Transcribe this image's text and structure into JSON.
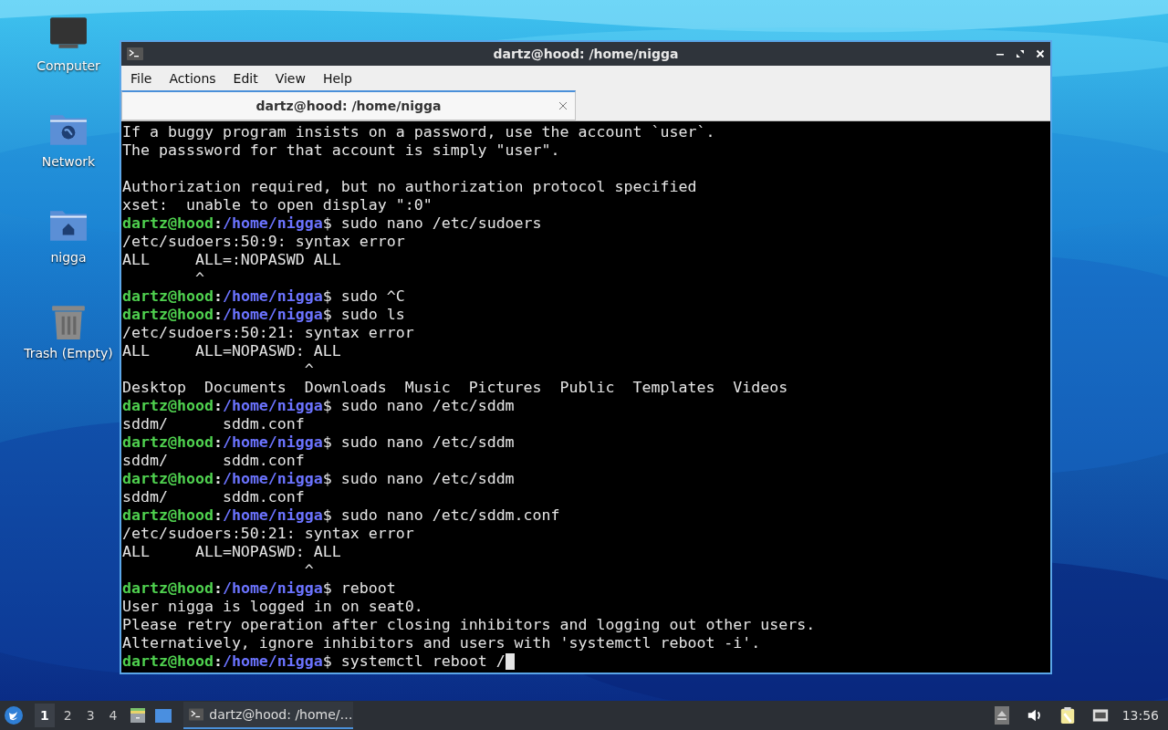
{
  "desktop_icons": [
    {
      "kind": "computer",
      "label": "Computer"
    },
    {
      "kind": "network",
      "label": "Network"
    },
    {
      "kind": "home",
      "label": "nigga"
    },
    {
      "kind": "trash",
      "label": "Trash (Empty)"
    }
  ],
  "window": {
    "title": "dartz@hood: /home/nigga",
    "menu": [
      "File",
      "Actions",
      "Edit",
      "View",
      "Help"
    ],
    "tabs": [
      {
        "label": "dartz@hood: /home/nigga",
        "selected": true
      }
    ],
    "terminal": [
      {
        "kind": "text",
        "text": "If a buggy program insists on a password, use the account `user`."
      },
      {
        "kind": "text",
        "text": "The passsword for that account is simply \"user\"."
      },
      {
        "kind": "blank"
      },
      {
        "kind": "text",
        "text": "Authorization required, but no authorization protocol specified"
      },
      {
        "kind": "text",
        "text": "xset:  unable to open display \":0\""
      },
      {
        "kind": "prompt",
        "user": "dartz@hood",
        "separator": ":",
        "path": "/home/nigga",
        "command": "$ sudo nano /etc/sudoers"
      },
      {
        "kind": "text",
        "text": "/etc/sudoers:50:9: syntax error"
      },
      {
        "kind": "text",
        "text": "ALL     ALL=:NOPASWD ALL"
      },
      {
        "kind": "text",
        "text": "        ^"
      },
      {
        "kind": "prompt",
        "user": "dartz@hood",
        "separator": ":",
        "path": "/home/nigga",
        "command": "$ sudo ^C"
      },
      {
        "kind": "prompt",
        "user": "dartz@hood",
        "separator": ":",
        "path": "/home/nigga",
        "command": "$ sudo ls"
      },
      {
        "kind": "text",
        "text": "/etc/sudoers:50:21: syntax error"
      },
      {
        "kind": "text",
        "text": "ALL     ALL=NOPASWD: ALL"
      },
      {
        "kind": "text",
        "text": "                    ^"
      },
      {
        "kind": "text",
        "text": "Desktop  Documents  Downloads  Music  Pictures  Public  Templates  Videos"
      },
      {
        "kind": "prompt",
        "user": "dartz@hood",
        "separator": ":",
        "path": "/home/nigga",
        "command": "$ sudo nano /etc/sddm"
      },
      {
        "kind": "text",
        "text": "sddm/      sddm.conf"
      },
      {
        "kind": "prompt",
        "user": "dartz@hood",
        "separator": ":",
        "path": "/home/nigga",
        "command": "$ sudo nano /etc/sddm"
      },
      {
        "kind": "text",
        "text": "sddm/      sddm.conf"
      },
      {
        "kind": "prompt",
        "user": "dartz@hood",
        "separator": ":",
        "path": "/home/nigga",
        "command": "$ sudo nano /etc/sddm"
      },
      {
        "kind": "text",
        "text": "sddm/      sddm.conf"
      },
      {
        "kind": "prompt",
        "user": "dartz@hood",
        "separator": ":",
        "path": "/home/nigga",
        "command": "$ sudo nano /etc/sddm.conf"
      },
      {
        "kind": "text",
        "text": "/etc/sudoers:50:21: syntax error"
      },
      {
        "kind": "text",
        "text": "ALL     ALL=NOPASWD: ALL"
      },
      {
        "kind": "text",
        "text": "                    ^"
      },
      {
        "kind": "prompt",
        "user": "dartz@hood",
        "separator": ":",
        "path": "/home/nigga",
        "command": "$ reboot"
      },
      {
        "kind": "text",
        "text": "User nigga is logged in on seat0."
      },
      {
        "kind": "text",
        "text": "Please retry operation after closing inhibitors and logging out other users."
      },
      {
        "kind": "text",
        "text": "Alternatively, ignore inhibitors and users with 'systemctl reboot -i'."
      },
      {
        "kind": "prompt",
        "user": "dartz@hood",
        "separator": ":",
        "path": "/home/nigga",
        "command": "$ systemctl reboot /",
        "cursor": true
      }
    ]
  },
  "taskbar": {
    "workspaces": [
      {
        "label": "1",
        "selected": true
      },
      {
        "label": "2",
        "selected": false
      },
      {
        "label": "3",
        "selected": false
      },
      {
        "label": "4",
        "selected": false
      }
    ],
    "tasks": [
      {
        "label": "dartz@hood: /home/…",
        "selected": true
      }
    ],
    "clock": "13:56"
  }
}
